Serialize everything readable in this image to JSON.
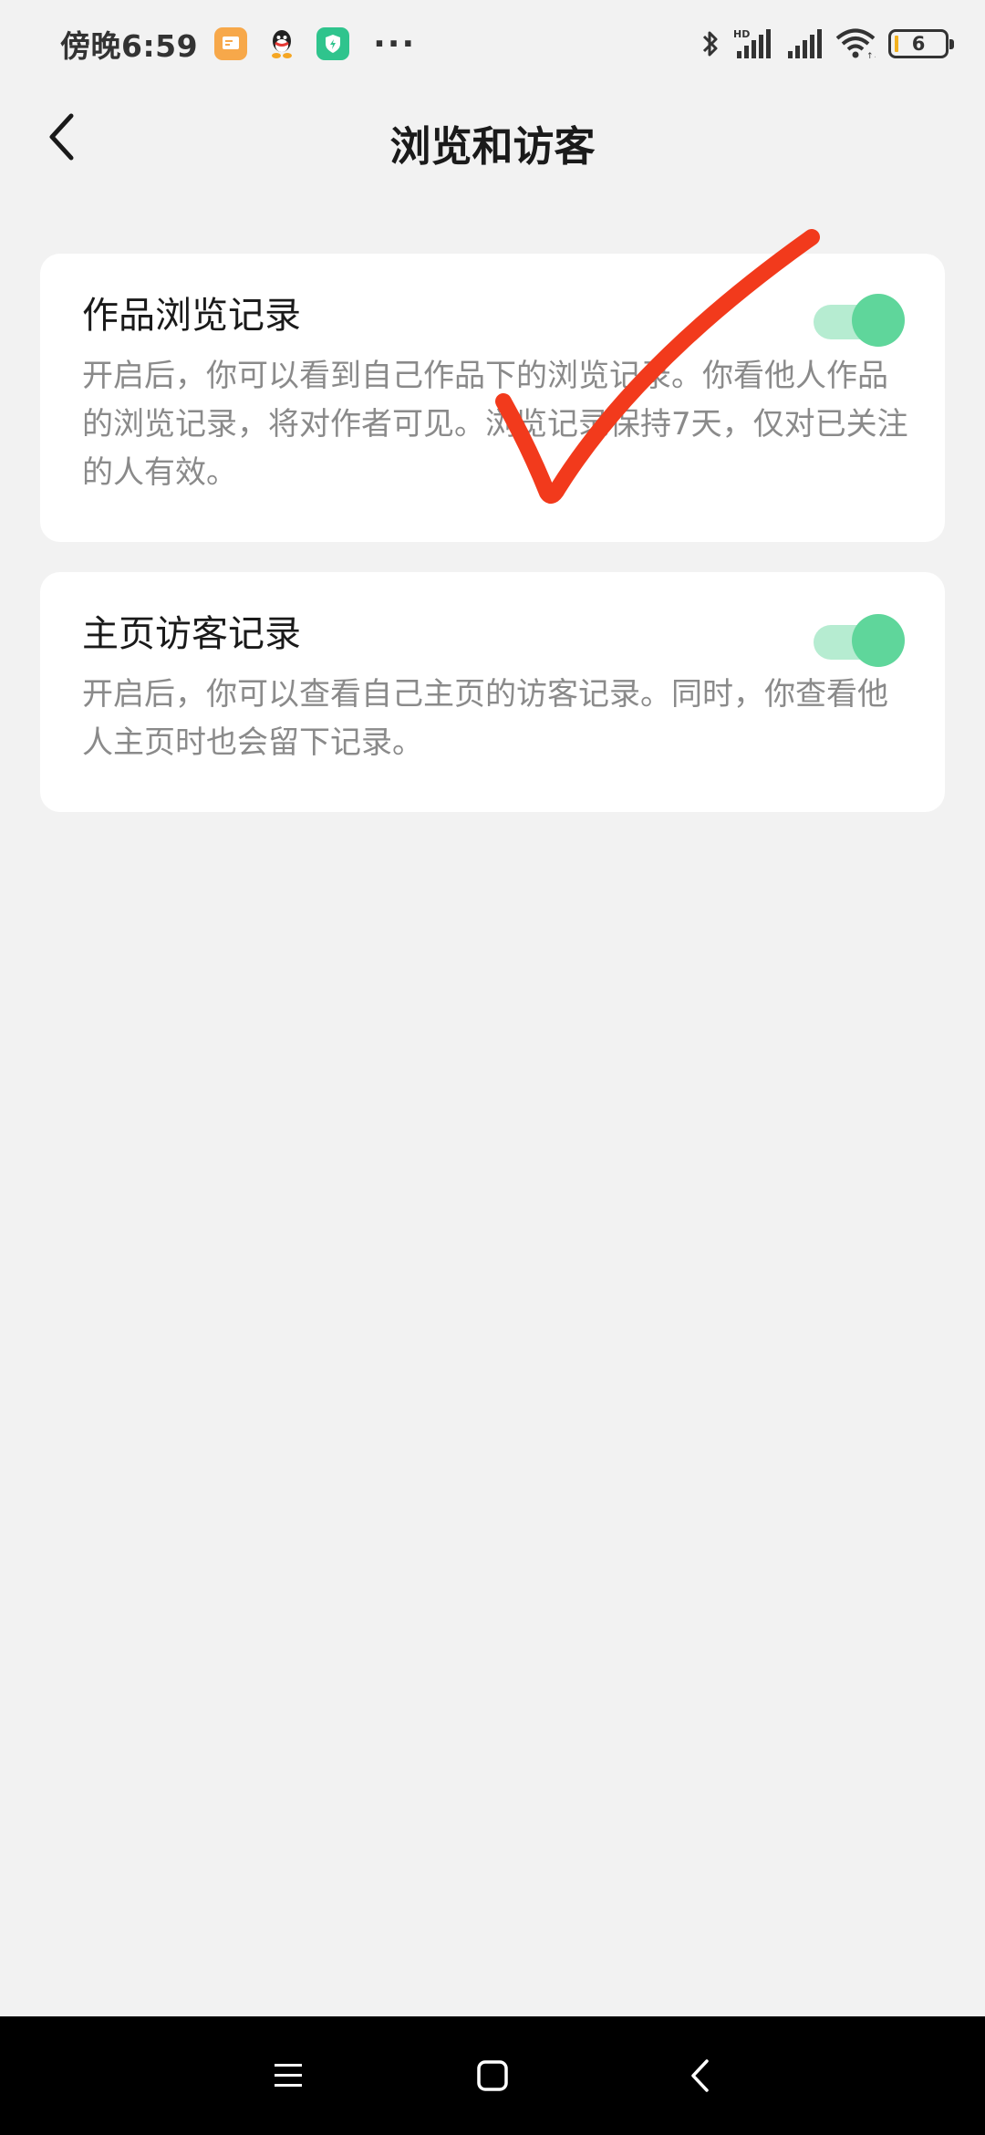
{
  "status_bar": {
    "time": "傍晚6:59",
    "more": "···",
    "battery": "6",
    "icons": [
      "gallery-app-icon",
      "qq-icon",
      "security-app-icon",
      "bluetooth-icon",
      "hd-signal-icon",
      "signal-icon",
      "wifi-icon",
      "battery-icon"
    ]
  },
  "header": {
    "title": "浏览和访客",
    "back_icon": "chevron-left-icon"
  },
  "settings": [
    {
      "title": "作品浏览记录",
      "description": "开启后，你可以看到自己作品下的浏览记录。你看他人作品的浏览记录，将对作者可见。浏览记录保持7天，仅对已关注的人有效。",
      "enabled": true
    },
    {
      "title": "主页访客记录",
      "description": "开启后，你可以查看自己主页的访客记录。同时，你查看他人主页时也会留下记录。",
      "enabled": true
    }
  ],
  "colors": {
    "background": "#f2f2f2",
    "card": "#ffffff",
    "toggle_track": "#b6ecd1",
    "toggle_knob": "#5fd69b",
    "annotation": "#f23a1c",
    "nav_bar": "#000000"
  },
  "annotation": {
    "type": "hand-drawn-checkmark"
  },
  "nav_bar": {
    "buttons": [
      "menu-icon",
      "home-icon",
      "back-icon"
    ]
  }
}
